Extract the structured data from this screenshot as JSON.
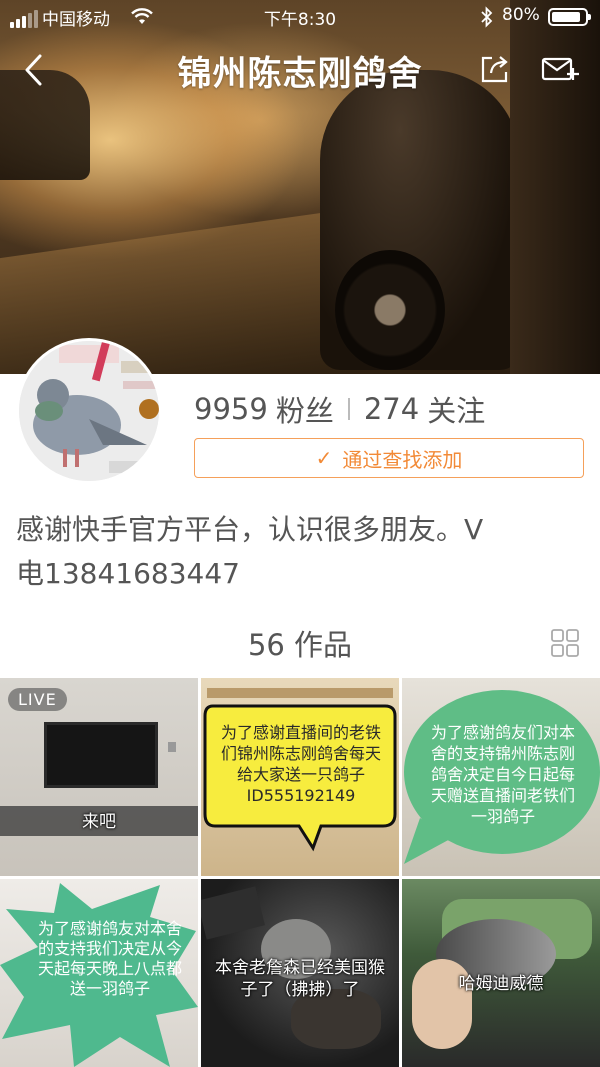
{
  "status_bar": {
    "carrier": "中国移动",
    "time": "下午8:30",
    "battery": "80%"
  },
  "nav": {
    "title": "锦州陈志刚鸽舍"
  },
  "profile": {
    "fans_count": "9959",
    "fans_label": "粉丝",
    "following_count": "274",
    "following_label": "关注",
    "add_button_label": "通过查找添加",
    "bio_line1": "感谢快手官方平台，认识很多朋友。V",
    "bio_line2": "电13841683447"
  },
  "works": {
    "count_label": "56 作品"
  },
  "grid": {
    "tiles": [
      {
        "live_badge": "LIVE",
        "caption": "来吧"
      },
      {
        "bubble": "为了感谢直播间的老铁们锦州陈志刚鸽舍每天给大家送一只鸽子ID555192149"
      },
      {
        "bubble": "为了感谢鸽友们对本舍的支持锦州陈志刚鸽舍决定自今日起每天赠送直播间老铁们一羽鸽子"
      },
      {
        "bubble": "为了感谢鸽友对本舍的支持我们决定从今天起每天晚上八点都送一羽鸽子"
      },
      {
        "caption": "本舍老詹森已经美国猴子了（拂拂）了"
      },
      {
        "caption": "哈姆迪威德"
      }
    ]
  },
  "colors": {
    "accent": "#f28a37",
    "bubble_green": "#5fbd86",
    "bubble_yellow": "#f7ec3e"
  }
}
